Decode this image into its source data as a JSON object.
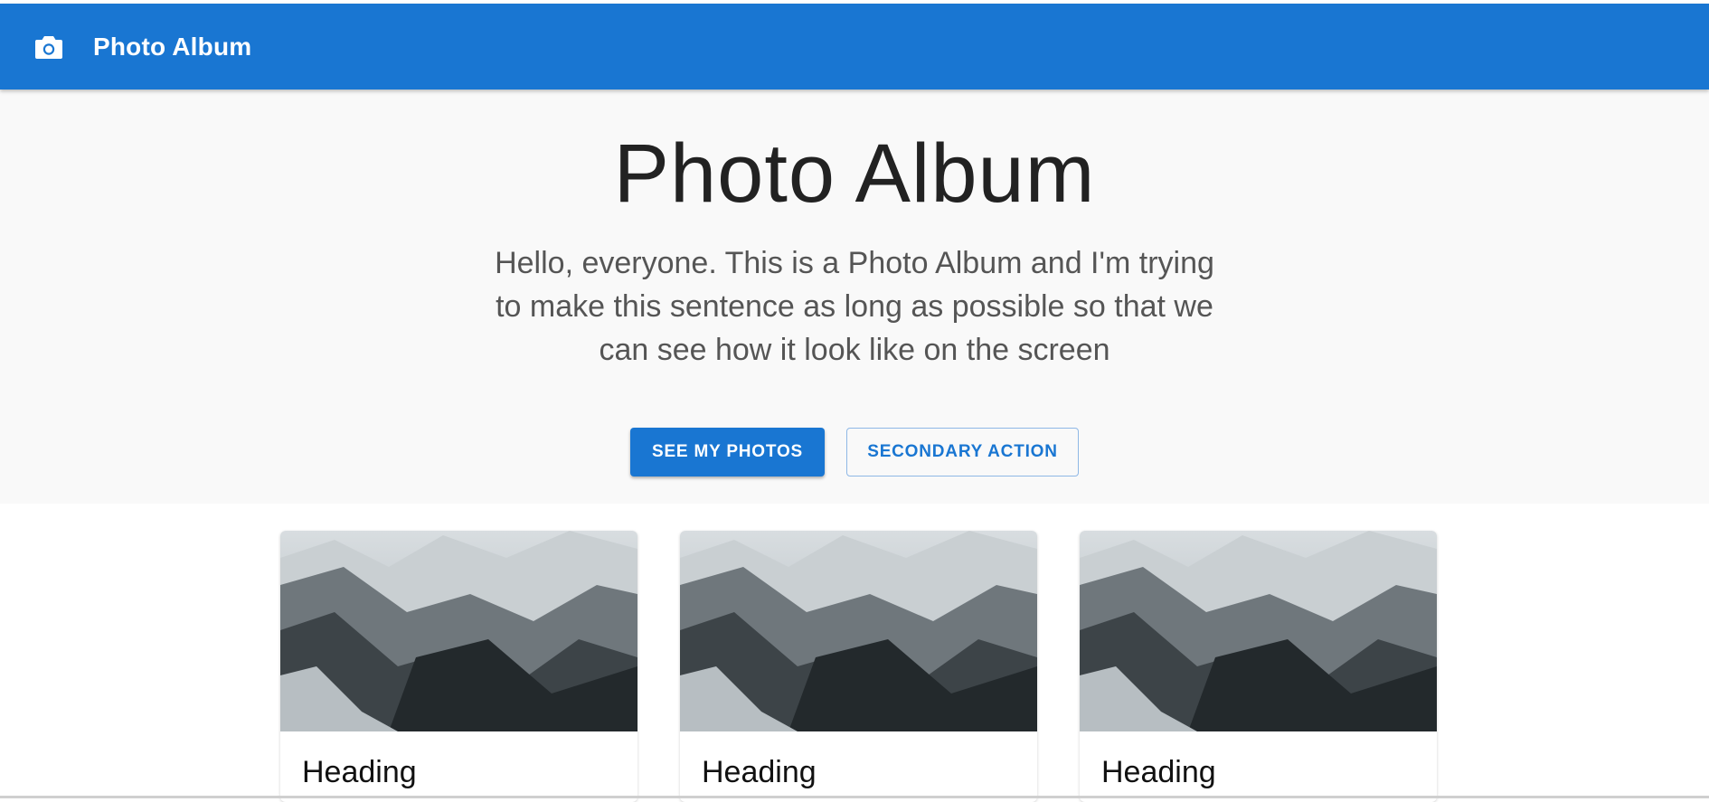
{
  "appbar": {
    "title": "Photo Album",
    "icon": "camera-icon",
    "color": "#1976d2"
  },
  "hero": {
    "title": "Photo Album",
    "lead": "Hello, everyone. This is a Photo Album and I'm trying to make this sentence as long as possible so that we can see how it look like on the screen",
    "primary_button": "SEE MY PHOTOS",
    "secondary_button": "SECONDARY ACTION"
  },
  "cards": [
    {
      "image": "mountain-landscape-photo",
      "heading": "Heading"
    },
    {
      "image": "mountain-landscape-photo",
      "heading": "Heading"
    },
    {
      "image": "mountain-landscape-photo",
      "heading": "Heading"
    }
  ]
}
